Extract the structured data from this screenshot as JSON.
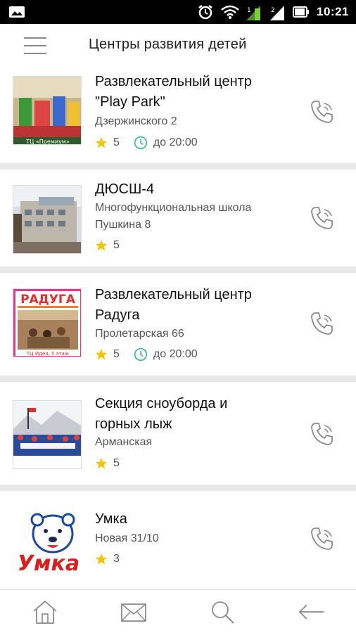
{
  "status_bar": {
    "time": "10:21",
    "icons": [
      "photo-icon",
      "alarm-icon",
      "wifi-icon",
      "signal-1-icon",
      "signal-2-icon",
      "battery-icon"
    ]
  },
  "header": {
    "title": "Центры развития детей",
    "menu_icon": "hamburger-menu-icon"
  },
  "items": [
    {
      "title_line1": "Развлекательный центр",
      "title_line2": "\"Play Park\"",
      "subtitle_line1": "Дзержинского 2",
      "rating": "5",
      "hours": "до 20:00",
      "thumb_caption": "ТЦ «Премиум»"
    },
    {
      "title_line1": "ДЮСШ-4",
      "subtitle_line1": "Многофункциональная школа",
      "subtitle_line2": "Пушкина 8",
      "rating": "5"
    },
    {
      "title_line1": "Развлекательный центр",
      "title_line2": "Радуга",
      "subtitle_line1": "Пролетарская 66",
      "rating": "5",
      "hours": "до 20:00",
      "thumb_logo": "РАДУГА",
      "thumb_caption": "ТЦ Идея, 5 этаж"
    },
    {
      "title_line1": "Секция сноуборда и",
      "title_line2": "горных лыж",
      "subtitle_line1": "Арманская",
      "rating": "5"
    },
    {
      "title_line1": "Умка",
      "subtitle_line1": "Новая 31/10",
      "rating": "3",
      "thumb_logo": "Умка"
    }
  ],
  "colors": {
    "star": "#f5c400",
    "clock": "#3cb6a4",
    "icon_gray": "#8a8a8a",
    "separator": "#e8e8e8"
  },
  "bottom_nav": {
    "icons": [
      "home-icon",
      "mail-icon",
      "search-icon",
      "back-arrow-icon"
    ]
  }
}
